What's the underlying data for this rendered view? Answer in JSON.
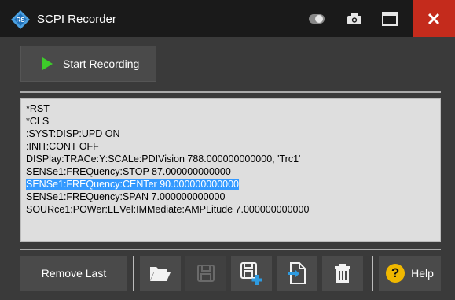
{
  "window": {
    "title": "SCPI Recorder",
    "buttons": {
      "toggle": "toggle-icon",
      "screenshot": "camera-icon",
      "maximize": "maximize-icon",
      "close": "close-icon"
    },
    "close_color": "#c42b1c"
  },
  "toolbar": {
    "start_label": "Start Recording",
    "accent_play": "#3dcc2a"
  },
  "log": {
    "lines": [
      {
        "text": "*RST",
        "selected": false
      },
      {
        "text": "*CLS",
        "selected": false
      },
      {
        "text": ":SYST:DISP:UPD ON",
        "selected": false
      },
      {
        "text": ":INIT:CONT OFF",
        "selected": false
      },
      {
        "text": "DISPlay:TRACe:Y:SCALe:PDIVision 788.000000000000, 'Trc1'",
        "selected": false
      },
      {
        "text": "SENSe1:FREQuency:STOP 87.000000000000",
        "selected": false
      },
      {
        "text": "SENSe1:FREQuency:CENTer 90.000000000000",
        "selected": true
      },
      {
        "text": "SENSe1:FREQuency:SPAN 7.000000000000",
        "selected": false
      },
      {
        "text": "SOURce1:POWer:LEVel:IMMediate:AMPLitude 7.000000000000",
        "selected": false
      }
    ],
    "selection_color": "#3399ff"
  },
  "bottom": {
    "remove_last_label": "Remove Last",
    "icons": {
      "open": "folder-open-icon",
      "save": "save-icon",
      "save_as": "save-as-icon",
      "export": "export-icon",
      "delete": "trash-icon"
    },
    "help_label": "Help",
    "help_color": "#f0b800"
  }
}
